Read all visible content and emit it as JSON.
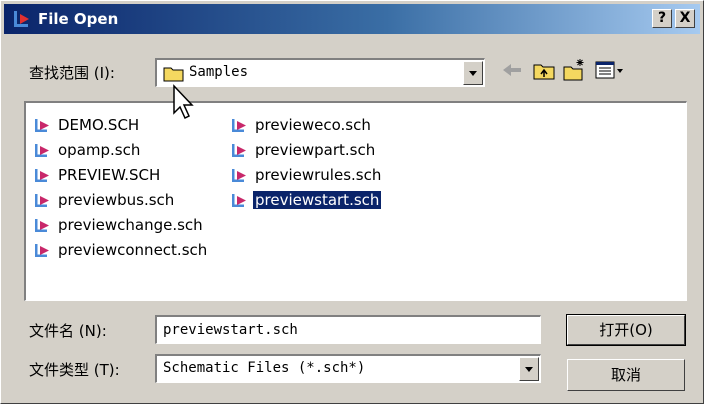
{
  "window": {
    "title": "File Open",
    "help_label": "?",
    "close_label": "X"
  },
  "lookin": {
    "label": "查找范围 (I):",
    "value": "Samples"
  },
  "toolbar": {
    "back": "back-arrow",
    "up": "up-folder",
    "new": "new-folder",
    "view": "view-menu"
  },
  "files": {
    "col1": [
      "DEMO.SCH",
      "opamp.sch",
      "PREVIEW.SCH",
      "previewbus.sch",
      "previewchange.sch",
      "previewconnect.sch"
    ],
    "col2": [
      "previeweco.sch",
      "previewpart.sch",
      "previewrules.sch",
      "previewstart.sch"
    ],
    "selected": "previewstart.sch"
  },
  "filename": {
    "label": "文件名 (N):",
    "value": "previewstart.sch"
  },
  "filetype": {
    "label": "文件类型 (T):",
    "value": "Schematic Files (*.sch*)"
  },
  "buttons": {
    "open": "打开(O)",
    "cancel": "取消"
  },
  "colors": {
    "titlebar": "#0a246a",
    "face": "#d4d0c8",
    "selection": "#0a246a"
  }
}
